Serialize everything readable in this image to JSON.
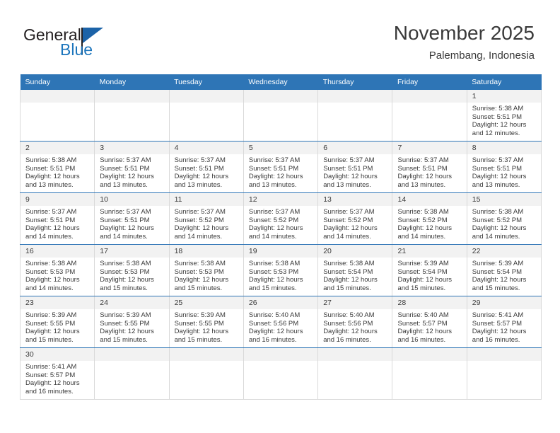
{
  "brand": {
    "name_top": "General",
    "name_bottom": "Blue",
    "flag_color": "#1c63a8",
    "blue_text_color": "#1c75bc"
  },
  "header": {
    "title": "November 2025",
    "subtitle": "Palembang, Indonesia"
  },
  "theme": {
    "header_blue": "#2e75b6",
    "daynum_band": "#f2f2f2",
    "text": "#3a3a3a",
    "grid_line": "#d9d9d9"
  },
  "weekdays": [
    "Sunday",
    "Monday",
    "Tuesday",
    "Wednesday",
    "Thursday",
    "Friday",
    "Saturday"
  ],
  "weeks": [
    [
      {
        "day": "",
        "sunrise": "",
        "sunset": "",
        "daylight": "",
        "daylight2": ""
      },
      {
        "day": "",
        "sunrise": "",
        "sunset": "",
        "daylight": "",
        "daylight2": ""
      },
      {
        "day": "",
        "sunrise": "",
        "sunset": "",
        "daylight": "",
        "daylight2": ""
      },
      {
        "day": "",
        "sunrise": "",
        "sunset": "",
        "daylight": "",
        "daylight2": ""
      },
      {
        "day": "",
        "sunrise": "",
        "sunset": "",
        "daylight": "",
        "daylight2": ""
      },
      {
        "day": "",
        "sunrise": "",
        "sunset": "",
        "daylight": "",
        "daylight2": ""
      },
      {
        "day": "1",
        "sunrise": "Sunrise: 5:38 AM",
        "sunset": "Sunset: 5:51 PM",
        "daylight": "Daylight: 12 hours",
        "daylight2": "and 12 minutes."
      }
    ],
    [
      {
        "day": "2",
        "sunrise": "Sunrise: 5:38 AM",
        "sunset": "Sunset: 5:51 PM",
        "daylight": "Daylight: 12 hours",
        "daylight2": "and 13 minutes."
      },
      {
        "day": "3",
        "sunrise": "Sunrise: 5:37 AM",
        "sunset": "Sunset: 5:51 PM",
        "daylight": "Daylight: 12 hours",
        "daylight2": "and 13 minutes."
      },
      {
        "day": "4",
        "sunrise": "Sunrise: 5:37 AM",
        "sunset": "Sunset: 5:51 PM",
        "daylight": "Daylight: 12 hours",
        "daylight2": "and 13 minutes."
      },
      {
        "day": "5",
        "sunrise": "Sunrise: 5:37 AM",
        "sunset": "Sunset: 5:51 PM",
        "daylight": "Daylight: 12 hours",
        "daylight2": "and 13 minutes."
      },
      {
        "day": "6",
        "sunrise": "Sunrise: 5:37 AM",
        "sunset": "Sunset: 5:51 PM",
        "daylight": "Daylight: 12 hours",
        "daylight2": "and 13 minutes."
      },
      {
        "day": "7",
        "sunrise": "Sunrise: 5:37 AM",
        "sunset": "Sunset: 5:51 PM",
        "daylight": "Daylight: 12 hours",
        "daylight2": "and 13 minutes."
      },
      {
        "day": "8",
        "sunrise": "Sunrise: 5:37 AM",
        "sunset": "Sunset: 5:51 PM",
        "daylight": "Daylight: 12 hours",
        "daylight2": "and 13 minutes."
      }
    ],
    [
      {
        "day": "9",
        "sunrise": "Sunrise: 5:37 AM",
        "sunset": "Sunset: 5:51 PM",
        "daylight": "Daylight: 12 hours",
        "daylight2": "and 14 minutes."
      },
      {
        "day": "10",
        "sunrise": "Sunrise: 5:37 AM",
        "sunset": "Sunset: 5:51 PM",
        "daylight": "Daylight: 12 hours",
        "daylight2": "and 14 minutes."
      },
      {
        "day": "11",
        "sunrise": "Sunrise: 5:37 AM",
        "sunset": "Sunset: 5:52 PM",
        "daylight": "Daylight: 12 hours",
        "daylight2": "and 14 minutes."
      },
      {
        "day": "12",
        "sunrise": "Sunrise: 5:37 AM",
        "sunset": "Sunset: 5:52 PM",
        "daylight": "Daylight: 12 hours",
        "daylight2": "and 14 minutes."
      },
      {
        "day": "13",
        "sunrise": "Sunrise: 5:37 AM",
        "sunset": "Sunset: 5:52 PM",
        "daylight": "Daylight: 12 hours",
        "daylight2": "and 14 minutes."
      },
      {
        "day": "14",
        "sunrise": "Sunrise: 5:38 AM",
        "sunset": "Sunset: 5:52 PM",
        "daylight": "Daylight: 12 hours",
        "daylight2": "and 14 minutes."
      },
      {
        "day": "15",
        "sunrise": "Sunrise: 5:38 AM",
        "sunset": "Sunset: 5:52 PM",
        "daylight": "Daylight: 12 hours",
        "daylight2": "and 14 minutes."
      }
    ],
    [
      {
        "day": "16",
        "sunrise": "Sunrise: 5:38 AM",
        "sunset": "Sunset: 5:53 PM",
        "daylight": "Daylight: 12 hours",
        "daylight2": "and 14 minutes."
      },
      {
        "day": "17",
        "sunrise": "Sunrise: 5:38 AM",
        "sunset": "Sunset: 5:53 PM",
        "daylight": "Daylight: 12 hours",
        "daylight2": "and 15 minutes."
      },
      {
        "day": "18",
        "sunrise": "Sunrise: 5:38 AM",
        "sunset": "Sunset: 5:53 PM",
        "daylight": "Daylight: 12 hours",
        "daylight2": "and 15 minutes."
      },
      {
        "day": "19",
        "sunrise": "Sunrise: 5:38 AM",
        "sunset": "Sunset: 5:53 PM",
        "daylight": "Daylight: 12 hours",
        "daylight2": "and 15 minutes."
      },
      {
        "day": "20",
        "sunrise": "Sunrise: 5:38 AM",
        "sunset": "Sunset: 5:54 PM",
        "daylight": "Daylight: 12 hours",
        "daylight2": "and 15 minutes."
      },
      {
        "day": "21",
        "sunrise": "Sunrise: 5:39 AM",
        "sunset": "Sunset: 5:54 PM",
        "daylight": "Daylight: 12 hours",
        "daylight2": "and 15 minutes."
      },
      {
        "day": "22",
        "sunrise": "Sunrise: 5:39 AM",
        "sunset": "Sunset: 5:54 PM",
        "daylight": "Daylight: 12 hours",
        "daylight2": "and 15 minutes."
      }
    ],
    [
      {
        "day": "23",
        "sunrise": "Sunrise: 5:39 AM",
        "sunset": "Sunset: 5:55 PM",
        "daylight": "Daylight: 12 hours",
        "daylight2": "and 15 minutes."
      },
      {
        "day": "24",
        "sunrise": "Sunrise: 5:39 AM",
        "sunset": "Sunset: 5:55 PM",
        "daylight": "Daylight: 12 hours",
        "daylight2": "and 15 minutes."
      },
      {
        "day": "25",
        "sunrise": "Sunrise: 5:39 AM",
        "sunset": "Sunset: 5:55 PM",
        "daylight": "Daylight: 12 hours",
        "daylight2": "and 15 minutes."
      },
      {
        "day": "26",
        "sunrise": "Sunrise: 5:40 AM",
        "sunset": "Sunset: 5:56 PM",
        "daylight": "Daylight: 12 hours",
        "daylight2": "and 16 minutes."
      },
      {
        "day": "27",
        "sunrise": "Sunrise: 5:40 AM",
        "sunset": "Sunset: 5:56 PM",
        "daylight": "Daylight: 12 hours",
        "daylight2": "and 16 minutes."
      },
      {
        "day": "28",
        "sunrise": "Sunrise: 5:40 AM",
        "sunset": "Sunset: 5:57 PM",
        "daylight": "Daylight: 12 hours",
        "daylight2": "and 16 minutes."
      },
      {
        "day": "29",
        "sunrise": "Sunrise: 5:41 AM",
        "sunset": "Sunset: 5:57 PM",
        "daylight": "Daylight: 12 hours",
        "daylight2": "and 16 minutes."
      }
    ],
    [
      {
        "day": "30",
        "sunrise": "Sunrise: 5:41 AM",
        "sunset": "Sunset: 5:57 PM",
        "daylight": "Daylight: 12 hours",
        "daylight2": "and 16 minutes."
      },
      {
        "day": "",
        "sunrise": "",
        "sunset": "",
        "daylight": "",
        "daylight2": ""
      },
      {
        "day": "",
        "sunrise": "",
        "sunset": "",
        "daylight": "",
        "daylight2": ""
      },
      {
        "day": "",
        "sunrise": "",
        "sunset": "",
        "daylight": "",
        "daylight2": ""
      },
      {
        "day": "",
        "sunrise": "",
        "sunset": "",
        "daylight": "",
        "daylight2": ""
      },
      {
        "day": "",
        "sunrise": "",
        "sunset": "",
        "daylight": "",
        "daylight2": ""
      },
      {
        "day": "",
        "sunrise": "",
        "sunset": "",
        "daylight": "",
        "daylight2": ""
      }
    ]
  ]
}
